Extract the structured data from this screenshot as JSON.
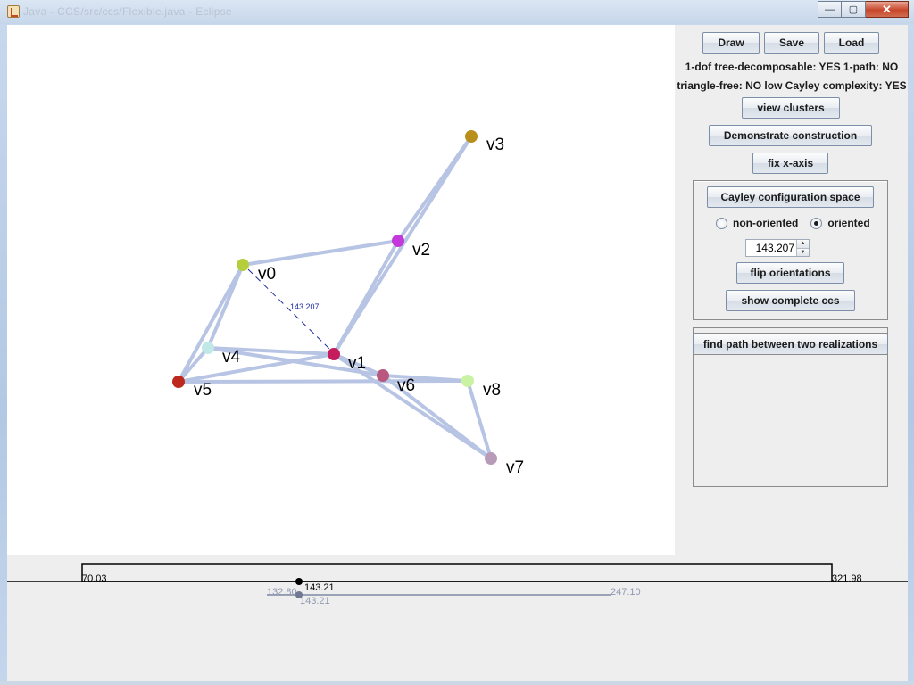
{
  "window": {
    "title": "Java - CCS/src/ccs/Flexible.java - Eclipse",
    "controls": {
      "minimize": "—",
      "maximize": "▢",
      "close": "✕"
    }
  },
  "toolbar": {
    "draw": "Draw",
    "save": "Save",
    "load": "Load"
  },
  "info": {
    "line1": "1-dof tree-decomposable: YES  1-path: NO",
    "line2": "triangle-free: NO  low Cayley complexity: YES"
  },
  "buttons": {
    "view_clusters": "view clusters",
    "demonstrate": "Demonstrate construction",
    "fix_x_axis": "fix x-axis",
    "cayley": "Cayley configuration space",
    "flip": "flip orientations",
    "show_ccs": "show complete ccs",
    "find_path": "find path between two realizations"
  },
  "radios": {
    "non_oriented": "non-oriented",
    "oriented": "oriented",
    "selected": "oriented"
  },
  "spinner": {
    "value": "143.207"
  },
  "graph": {
    "vertices": [
      {
        "id": "v0",
        "label": "v0",
        "color": "#b5cf3c"
      },
      {
        "id": "v1",
        "label": "v1",
        "color": "#c51c5d"
      },
      {
        "id": "v2",
        "label": "v2",
        "color": "#c438dc"
      },
      {
        "id": "v3",
        "label": "v3",
        "color": "#b98f1b"
      },
      {
        "id": "v4",
        "label": "v4",
        "color": "#bfe8e6"
      },
      {
        "id": "v5",
        "label": "v5",
        "color": "#bd2a1d"
      },
      {
        "id": "v6",
        "label": "v6",
        "color": "#b9577f"
      },
      {
        "id": "v7",
        "label": "v7",
        "color": "#b89ab9"
      },
      {
        "id": "v8",
        "label": "v8",
        "color": "#c9f2a2"
      }
    ],
    "edge_color": "#b7c4e3",
    "dashed_edge_label": "143.207",
    "dashed_edge_color": "#1c2a9c"
  },
  "interval": {
    "min": "70.03",
    "max": "321.98",
    "current": "143.21",
    "sub_min": "132.80",
    "sub_max": "247.10",
    "sub_current": "143.21"
  }
}
